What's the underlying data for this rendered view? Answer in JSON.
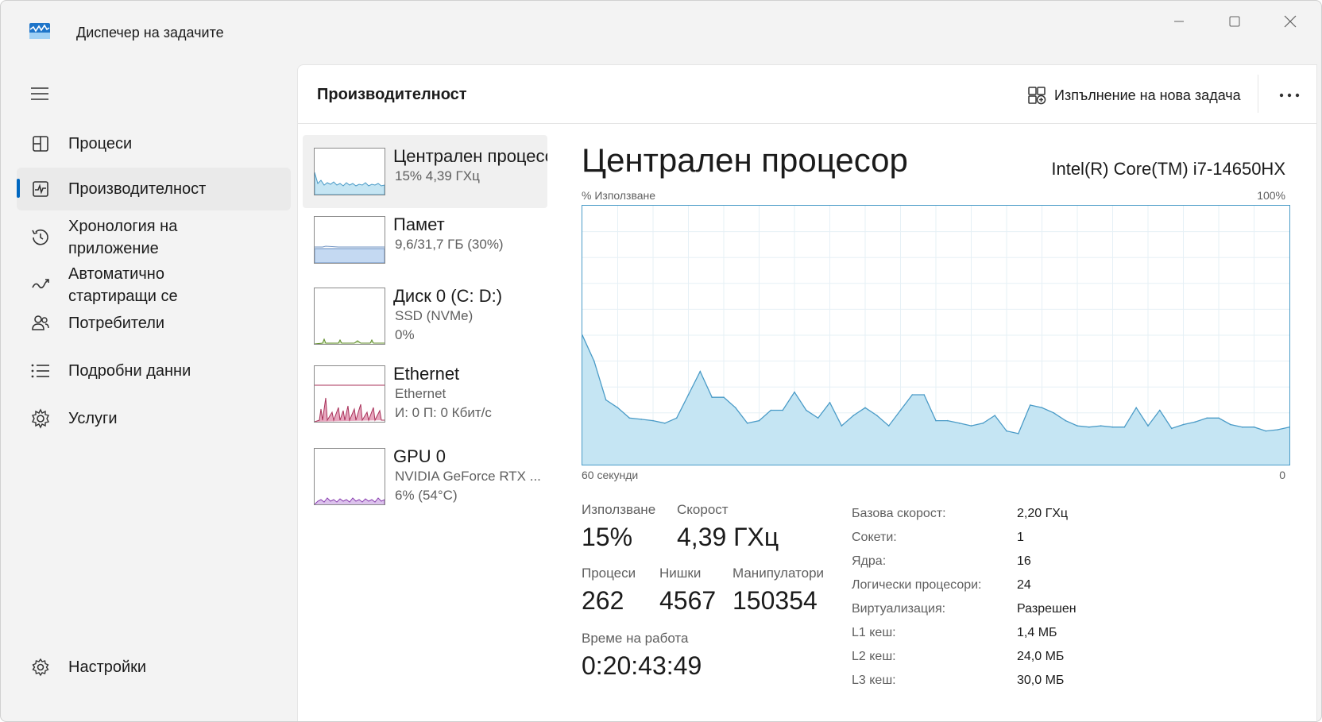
{
  "titlebar": {
    "title": "Диспечер на задачите",
    "icons": {
      "app": "task-manager-icon",
      "minimize": "minimize-icon",
      "maximize": "maximize-icon",
      "close": "close-icon"
    }
  },
  "sidebar": {
    "menu_icon": "hamburger-icon",
    "items": [
      {
        "label": "Процеси",
        "icon": "processes-icon"
      },
      {
        "label": "Производителност",
        "icon": "performance-icon",
        "active": true
      },
      {
        "label": "Хронология на\nприложение",
        "icon": "history-icon"
      },
      {
        "label": "Автоматично\nстартиращи се",
        "icon": "startup-icon"
      },
      {
        "label": "Потребители",
        "icon": "users-icon"
      },
      {
        "label": "Подробни данни",
        "icon": "details-icon"
      },
      {
        "label": "Услуги",
        "icon": "services-icon"
      }
    ],
    "settings": {
      "label": "Настройки",
      "icon": "gear-icon"
    }
  },
  "header": {
    "title": "Производителност",
    "run_task_label": "Изпълнение на нова задача",
    "run_task_icon": "run-task-icon",
    "more_icon": "more-icon"
  },
  "resources": [
    {
      "name": "Централен процесор",
      "line1": "15%  4,39 ГХц",
      "line2": "",
      "color": "#4a9bc7",
      "fill": "#c5e5f3"
    },
    {
      "name": "Памет",
      "line1": "9,6/31,7 ГБ (30%)",
      "line2": "",
      "color": "#6a8fc0",
      "fill": "#c4d9f2"
    },
    {
      "name": "Диск 0 (C: D:)",
      "line1": "SSD (NVMe)",
      "line2": "0%",
      "color": "#5c8a26",
      "fill": "#d4e8bf"
    },
    {
      "name": "Ethernet",
      "line1": "Ethernet",
      "line2": "И: 0  П: 0 Кбит/с",
      "color": "#a8325a",
      "fill": "#e8a7bf"
    },
    {
      "name": "GPU 0",
      "line1": "NVIDIA GeForce RTX ...",
      "line2": "6%  (54°C)",
      "color": "#8a3fb0",
      "fill": "#dcc2ec"
    }
  ],
  "detail": {
    "title": "Централен процесор",
    "model": "Intel(R) Core(TM) i7-14650HX",
    "axis_top_left": "% Използване",
    "axis_top_right": "100%",
    "axis_bottom_left": "60 секунди",
    "axis_bottom_right": "0",
    "stats": {
      "usage": {
        "label": "Използване",
        "value": "15%"
      },
      "speed": {
        "label": "Скорост",
        "value": "4,39 ГХц"
      },
      "processes": {
        "label": "Процеси",
        "value": "262"
      },
      "threads": {
        "label": "Нишки",
        "value": "4567"
      },
      "handles": {
        "label": "Манипулатори",
        "value": "150354"
      },
      "uptime": {
        "label": "Време на работа",
        "value": "0:20:43:49"
      }
    },
    "specs": [
      {
        "k": "Базова скорост:",
        "v": "2,20 ГХц"
      },
      {
        "k": "Сокети:",
        "v": "1"
      },
      {
        "k": "Ядра:",
        "v": "16"
      },
      {
        "k": "Логически процесори:",
        "v": "24"
      },
      {
        "k": "Виртуализация:",
        "v": "Разрешен"
      },
      {
        "k": "L1 кеш:",
        "v": "1,4 МБ"
      },
      {
        "k": "L2 кеш:",
        "v": "24,0 МБ"
      },
      {
        "k": "L3 кеш:",
        "v": "30,0 МБ"
      }
    ]
  },
  "chart_data": {
    "type": "area",
    "x_label": "60 секунди",
    "ylim": [
      0,
      100
    ],
    "grid": true,
    "values": [
      50,
      40,
      25,
      22,
      18,
      17.5,
      17,
      16,
      18,
      27,
      36,
      26,
      26,
      22,
      16,
      17,
      21,
      21,
      28,
      21,
      18,
      24,
      15,
      19,
      22,
      19,
      15,
      21,
      27,
      27,
      17,
      17,
      16,
      15,
      16,
      19,
      13,
      12,
      23,
      22,
      20,
      17,
      15,
      14.5,
      15,
      14.5,
      14.5,
      22,
      15,
      21,
      14,
      15.5,
      16.5,
      18,
      18,
      15.5,
      14.5,
      14.5,
      13,
      13.5,
      14.5
    ]
  }
}
